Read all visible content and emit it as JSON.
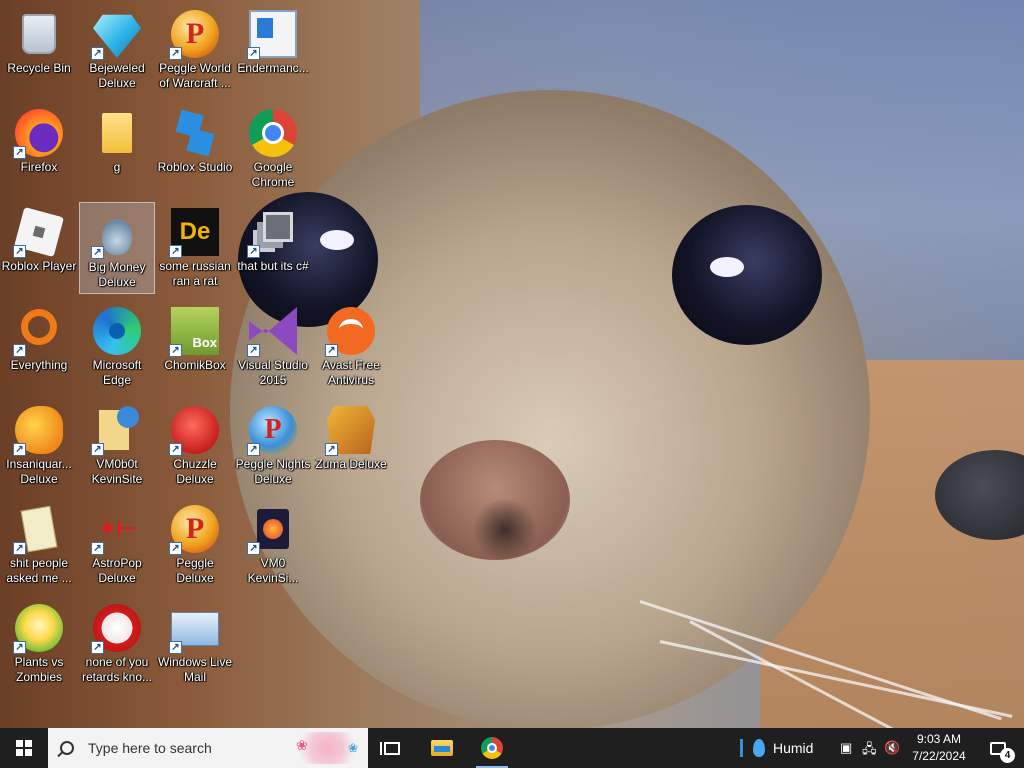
{
  "desktop": {
    "icons": [
      {
        "label": "Recycle Bin",
        "icon": "recycle-bin-icon"
      },
      {
        "label": "Bejeweled Deluxe",
        "icon": "bejeweled-gem-icon"
      },
      {
        "label": "Peggle World of Warcraft ...",
        "icon": "peggle-icon"
      },
      {
        "label": "Endermanc...",
        "icon": "window-app-icon"
      },
      {
        "label": "Firefox",
        "icon": "firefox-icon"
      },
      {
        "label": "g",
        "icon": "folder-icon"
      },
      {
        "label": "Roblox Studio",
        "icon": "roblox-studio-icon"
      },
      {
        "label": "Google Chrome",
        "icon": "chrome-icon"
      },
      {
        "label": "Roblox Player",
        "icon": "roblox-player-icon"
      },
      {
        "label": "Big Money Deluxe",
        "icon": "money-bag-icon"
      },
      {
        "label": "some russian ran a rat",
        "icon": "dice-game-icon"
      },
      {
        "label": "that but its c#",
        "icon": "stacked-windows-icon"
      },
      {
        "label": "Everything",
        "icon": "everything-search-icon"
      },
      {
        "label": "Microsoft Edge",
        "icon": "edge-icon"
      },
      {
        "label": "ChomikBox",
        "icon": "chomikbox-icon"
      },
      {
        "label": "Visual Studio 2015",
        "icon": "visual-studio-icon"
      },
      {
        "label": "Avast Free Antivirus",
        "icon": "avast-icon"
      },
      {
        "label": "Insaniquar... Deluxe",
        "icon": "fish-icon"
      },
      {
        "label": "VM0b0t KevinSite",
        "icon": "vm-document-icon"
      },
      {
        "label": "Chuzzle Deluxe",
        "icon": "chuzzle-icon"
      },
      {
        "label": "Peggle Nights Deluxe",
        "icon": "peggle-nights-icon"
      },
      {
        "label": "Zuma Deluxe",
        "icon": "zuma-icon"
      },
      {
        "label": "shit people asked me ...",
        "icon": "document-icon"
      },
      {
        "label": "AstroPop Deluxe",
        "icon": "astropop-icon"
      },
      {
        "label": "Peggle Deluxe",
        "icon": "peggle-icon"
      },
      {
        "label": "VM0 KevinSi...",
        "icon": "vm0-firefox-icon"
      },
      {
        "label": "Plants vs Zombies",
        "icon": "plants-vs-zombies-icon"
      },
      {
        "label": "none of you retards kno...",
        "icon": "red-dragon-icon"
      },
      {
        "label": "Windows Live Mail",
        "icon": "mail-icon"
      }
    ],
    "selected": "Big Money Deluxe"
  },
  "taskbar": {
    "search_placeholder": "Type here to search",
    "weather": "Humid",
    "time": "9:03 AM",
    "date": "7/22/2024",
    "notification_count": "4"
  },
  "colors": {
    "taskbar_bg": "#1f1f1f",
    "search_bg": "#f3f3f3",
    "selection": "#d2e1f5"
  }
}
